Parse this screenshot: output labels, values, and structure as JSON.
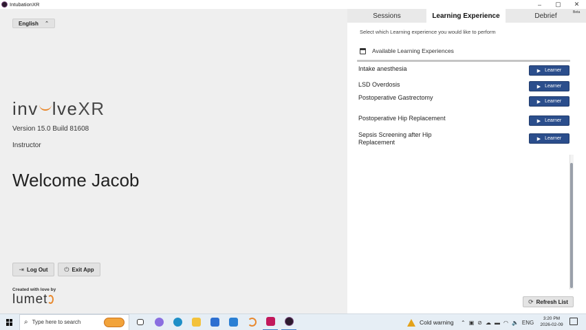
{
  "window": {
    "title": "IntubationXR",
    "controls": {
      "minimize": "–",
      "maximize": "▢",
      "close": "✕"
    }
  },
  "left": {
    "language": "English",
    "logo": {
      "pre": "inv",
      "mid": "lve",
      "post": "XR"
    },
    "version": "Version 15.0 Build 81608",
    "role": "Instructor",
    "welcome": "Welcome Jacob",
    "logout_label": "Log Out",
    "exit_label": "Exit App",
    "created_by": "Created with love by",
    "brand": "lumet"
  },
  "right": {
    "tabs": [
      {
        "label": "Sessions"
      },
      {
        "label": "Learning Experience",
        "active": true
      },
      {
        "label": "Debrief",
        "badge": "Beta"
      }
    ],
    "instruction": "Select which Learning experience you would like to perform",
    "section_title": "Available Learning Experiences",
    "experiences": [
      {
        "name": "Intake anesthesia",
        "action": "Learner"
      },
      {
        "name": "LSD Overdosis",
        "action": "Learner"
      },
      {
        "name": "Postoperative Gastrectomy",
        "action": "Learner"
      },
      {
        "name": "Postoperative Hip Replacement",
        "action": "Learner"
      },
      {
        "name": "Sepsis Screening after Hip Replacement",
        "action": "Learner"
      }
    ],
    "refresh_label": "Refresh List"
  },
  "taskbar": {
    "search_placeholder": "Type here to search",
    "weather": "Cold warning",
    "language": "ENG",
    "time": "3:20 PM",
    "date": "2026-02-09"
  },
  "colors": {
    "accent_orange": "#e8882d",
    "learner_button": "#2b4e8c",
    "warning": "#e3a21a"
  }
}
